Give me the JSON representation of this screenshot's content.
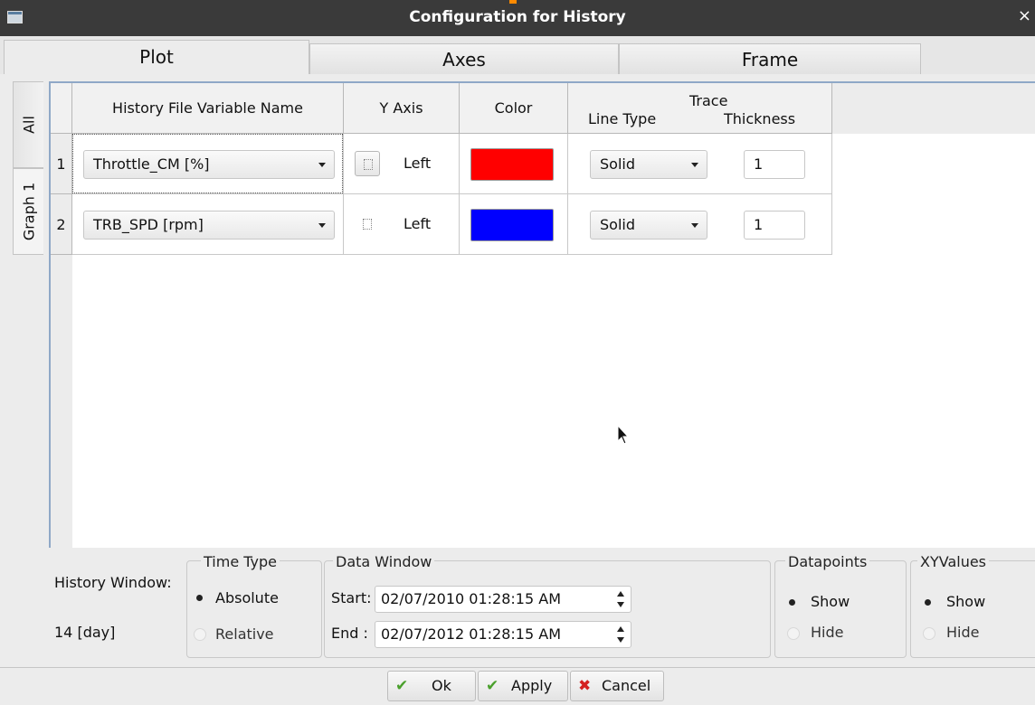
{
  "window": {
    "title": "Configuration for History",
    "close_glyph": "×"
  },
  "tabs": [
    {
      "label": "Plot",
      "active": true
    },
    {
      "label": "Axes",
      "active": false
    },
    {
      "label": "Frame",
      "active": false
    }
  ],
  "side_tabs": [
    {
      "label": "All",
      "active": false
    },
    {
      "label": "Graph 1",
      "active": true
    }
  ],
  "table": {
    "headers": {
      "variable": "History File Variable Name",
      "y_axis": "Y Axis",
      "color": "Color",
      "trace": "Trace",
      "line_type": "Line Type",
      "thickness": "Thickness"
    },
    "rows": [
      {
        "num": "1",
        "variable": "Throttle_CM [%]",
        "axis": "Left",
        "color": "#ff0000",
        "line_type": "Solid",
        "thickness": "1"
      },
      {
        "num": "2",
        "variable": "TRB_SPD [rpm]",
        "axis": "Left",
        "color": "#0000ff",
        "line_type": "Solid",
        "thickness": "1"
      }
    ]
  },
  "history_window": {
    "label": "History Window:",
    "value": "14 [day]"
  },
  "time_type": {
    "title": "Time Type",
    "options": [
      "Absolute",
      "Relative"
    ],
    "selected": "Absolute"
  },
  "data_window": {
    "title": "Data Window",
    "start_label": "Start:",
    "start_value": "02/07/2010 01:28:15 AM",
    "end_label": "End :",
    "end_value": "02/07/2012 01:28:15 AM"
  },
  "datapoints": {
    "title": "Datapoints",
    "options": [
      "Show",
      "Hide"
    ],
    "selected": "Show"
  },
  "xyvalues": {
    "title": "XYValues",
    "options": [
      "Show",
      "Hide"
    ],
    "selected": "Show"
  },
  "buttons": {
    "ok": "Ok",
    "apply": "Apply",
    "cancel": "Cancel"
  },
  "colors": {
    "titlebar": "#3a3a3a",
    "accent_border": "#8fa8c7",
    "ok_check": "#4aa02c",
    "cancel_x": "#d42020"
  }
}
